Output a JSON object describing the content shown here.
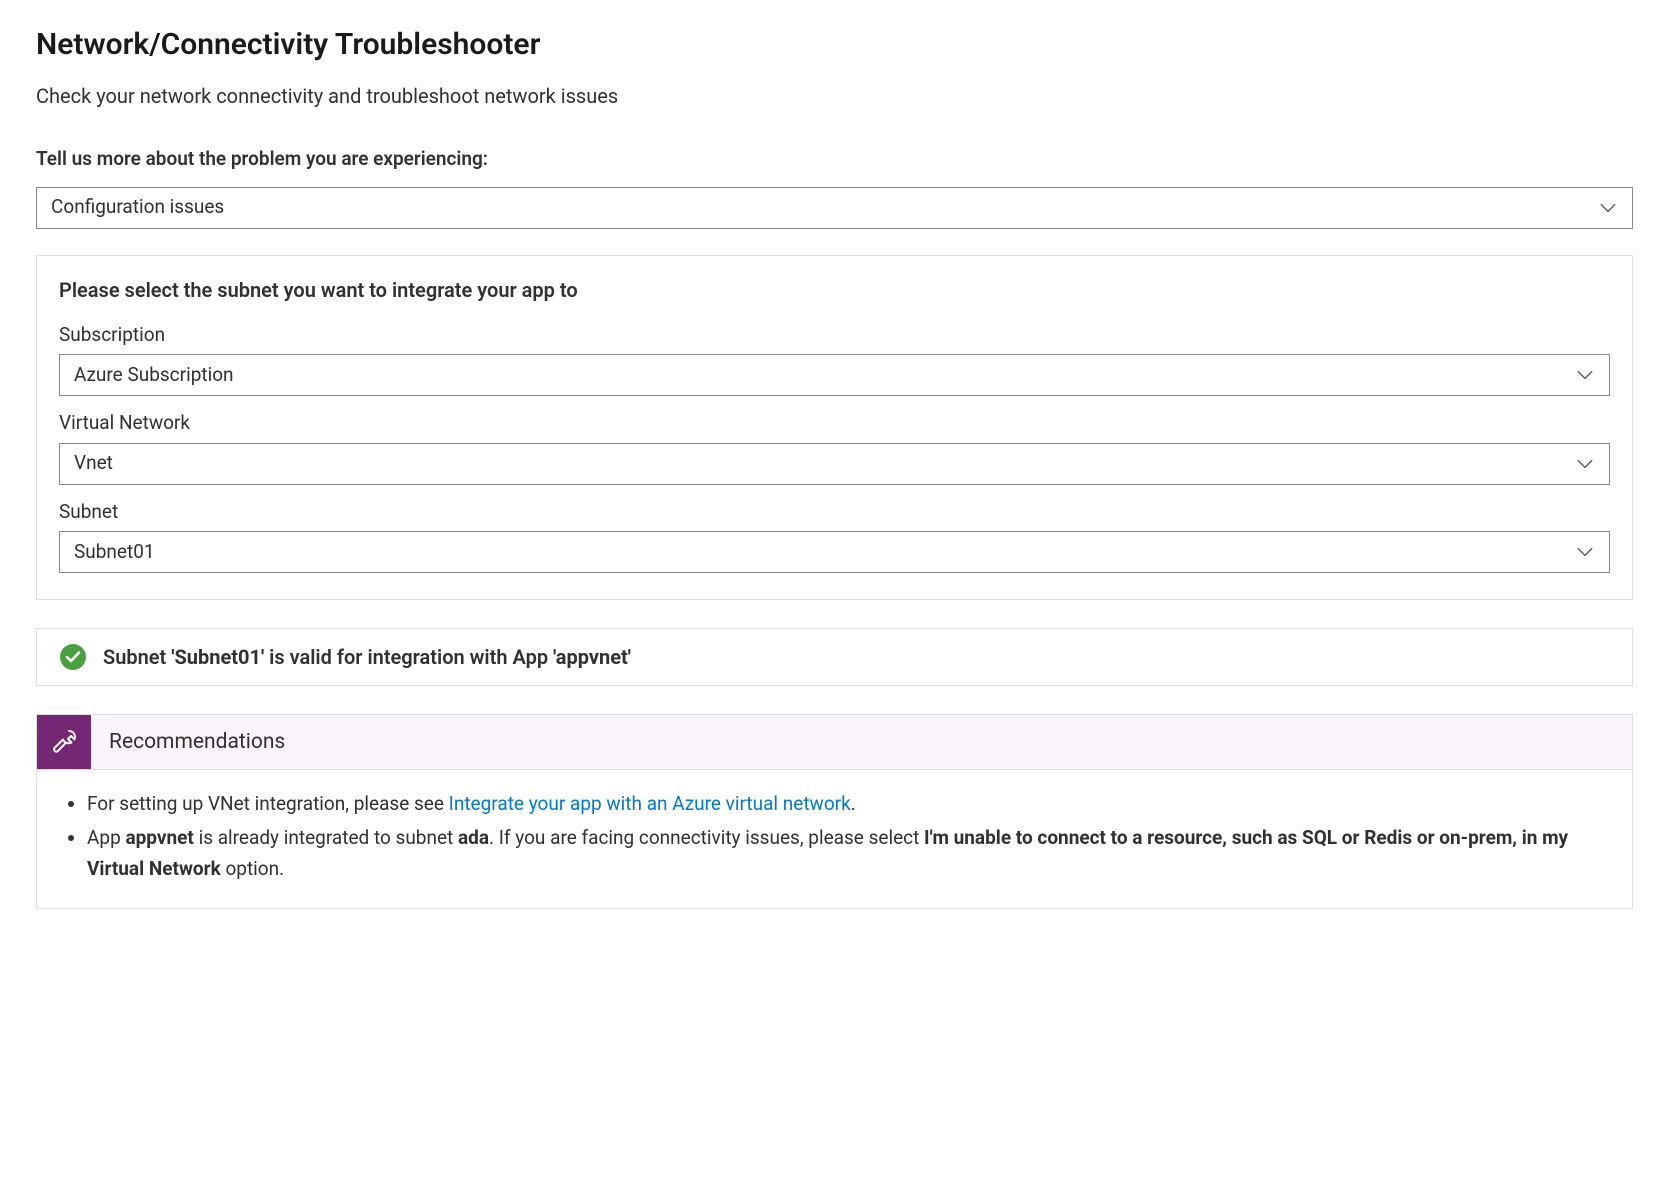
{
  "header": {
    "title": "Network/Connectivity Troubleshooter",
    "subtitle": "Check your network connectivity and troubleshoot network issues"
  },
  "problem": {
    "prompt": "Tell us more about the problem you are experiencing:",
    "selected": "Configuration issues"
  },
  "subnet_panel": {
    "heading": "Please select the subnet you want to integrate your app to",
    "fields": {
      "subscription": {
        "label": "Subscription",
        "value": "Azure Subscription"
      },
      "vnet": {
        "label": "Virtual Network",
        "value": "Vnet"
      },
      "subnet": {
        "label": "Subnet",
        "value": "Subnet01"
      }
    }
  },
  "status": {
    "prefix": "Subnet ",
    "subnet_quoted": "'Subnet01'",
    "middle": " is valid for integration with App ",
    "app_quoted": "'appvnet'"
  },
  "recommendations": {
    "title": "Recommendations",
    "item1": {
      "pre": "For setting up VNet integration, please see ",
      "link": "Integrate your app with an Azure virtual network",
      "post": "."
    },
    "item2": {
      "t1": "App ",
      "b1": "appvnet",
      "t2": " is already integrated to subnet ",
      "b2": "ada",
      "t3": ". If you are facing connectivity issues, please select ",
      "b3": "I'm unable to connect to a resource, such as SQL or Redis or on-prem, in my Virtual Network",
      "t4": " option."
    }
  }
}
